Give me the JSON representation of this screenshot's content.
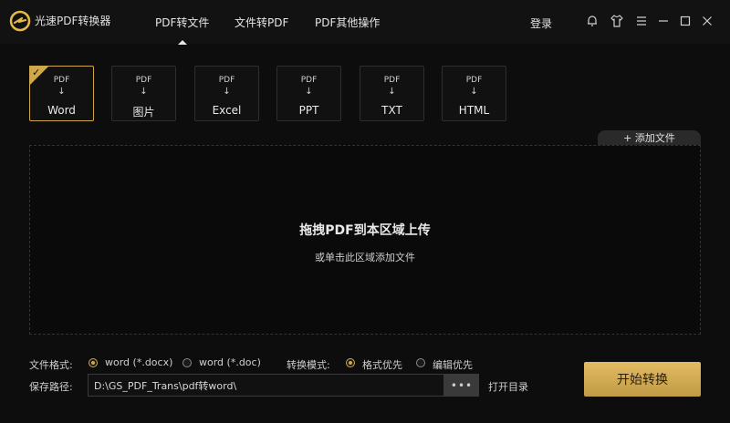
{
  "app": {
    "title": "光速PDF转换器"
  },
  "nav": {
    "tabs": [
      {
        "label": "PDF转文件",
        "active": true
      },
      {
        "label": "文件转PDF",
        "active": false
      },
      {
        "label": "PDF其他操作",
        "active": false
      }
    ],
    "login": "登录"
  },
  "window_controls": [
    "bell-icon",
    "shirt-icon",
    "menu-icon",
    "minimize-icon",
    "maximize-icon",
    "close-icon"
  ],
  "formats": [
    {
      "top": "PDF",
      "arrow": "↓",
      "label": "Word",
      "selected": true
    },
    {
      "top": "PDF",
      "arrow": "↓",
      "label": "图片",
      "selected": false
    },
    {
      "top": "PDF",
      "arrow": "↓",
      "label": "Excel",
      "selected": false
    },
    {
      "top": "PDF",
      "arrow": "↓",
      "label": "PPT",
      "selected": false
    },
    {
      "top": "PDF",
      "arrow": "↓",
      "label": "TXT",
      "selected": false
    },
    {
      "top": "PDF",
      "arrow": "↓",
      "label": "HTML",
      "selected": false
    }
  ],
  "add_file": "+ 添加文件",
  "dropzone": {
    "title": "拖拽PDF到本区域上传",
    "subtitle": "或单击此区域添加文件"
  },
  "options": {
    "format_label": "文件格式:",
    "format_opt1": "word (*.docx)",
    "format_opt2": "word (*.doc)",
    "format_selected": "word (*.docx)",
    "mode_label": "转换模式:",
    "mode_opt1": "格式优先",
    "mode_opt2": "编辑优先",
    "mode_selected": "格式优先",
    "path_label": "保存路径:",
    "path_value": "D:\\GS_PDF_Trans\\pdf转word\\",
    "browse": "•••",
    "open_dir": "打开目录",
    "start": "开始转换"
  },
  "colors": {
    "accent": "#cfa84b",
    "background": "#0d0d0d"
  }
}
